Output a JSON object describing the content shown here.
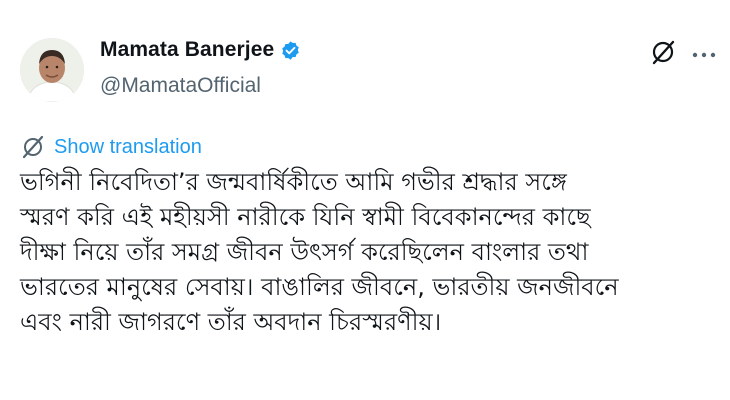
{
  "author": {
    "display_name": "Mamata Banerjee",
    "handle": "@MamataOfficial",
    "verified": true
  },
  "actions": {
    "grok_icon": "grok-icon",
    "more_icon": "more-horizontal-icon"
  },
  "translation": {
    "label": "Show translation",
    "icon": "translate-icon"
  },
  "tweet": {
    "text": "ভগিনী নিবেদিতা’র জন্মবার্ষিকীতে আমি গভীর শ্রদ্ধার সঙ্গে\nস্মরণ করি এই মহীয়সী নারীকে যিনি স্বামী বিবেকানন্দের কাছে\nদীক্ষা নিয়ে তাঁর সমগ্র জীবন উৎসর্গ করেছিলেন বাংলার তথা\nভারতের মানুষের সেবায়। বাঙালির জীবনে, ভারতীয় জনজীবনে\nএবং নারী জাগরণে তাঁর অবদান চিরস্মরণীয়।"
  },
  "colors": {
    "text": "#0f1419",
    "secondary": "#536471",
    "accent": "#1d9bf0"
  }
}
